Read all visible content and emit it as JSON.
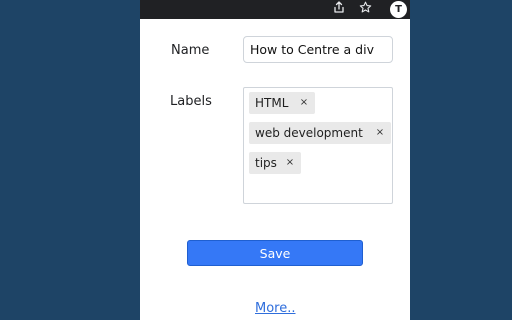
{
  "toolbar": {
    "icons": [
      "share-icon",
      "star-icon",
      "profile-icon"
    ],
    "profile_initial": "T"
  },
  "form": {
    "name_label": "Name",
    "name_value": "How to Centre a div",
    "labels_label": "Labels",
    "tags": [
      {
        "label": "HTML",
        "remove": "×"
      },
      {
        "label": "web development",
        "remove": "×"
      },
      {
        "label": "tips",
        "remove": "×"
      }
    ],
    "save_label": "Save",
    "more_label": "More.."
  },
  "colors": {
    "page_background": "#1e4466",
    "toolbar_background": "#202124",
    "save_button": "#3578f6",
    "link": "#2f6edc",
    "tag_background": "#e9e9e9"
  }
}
